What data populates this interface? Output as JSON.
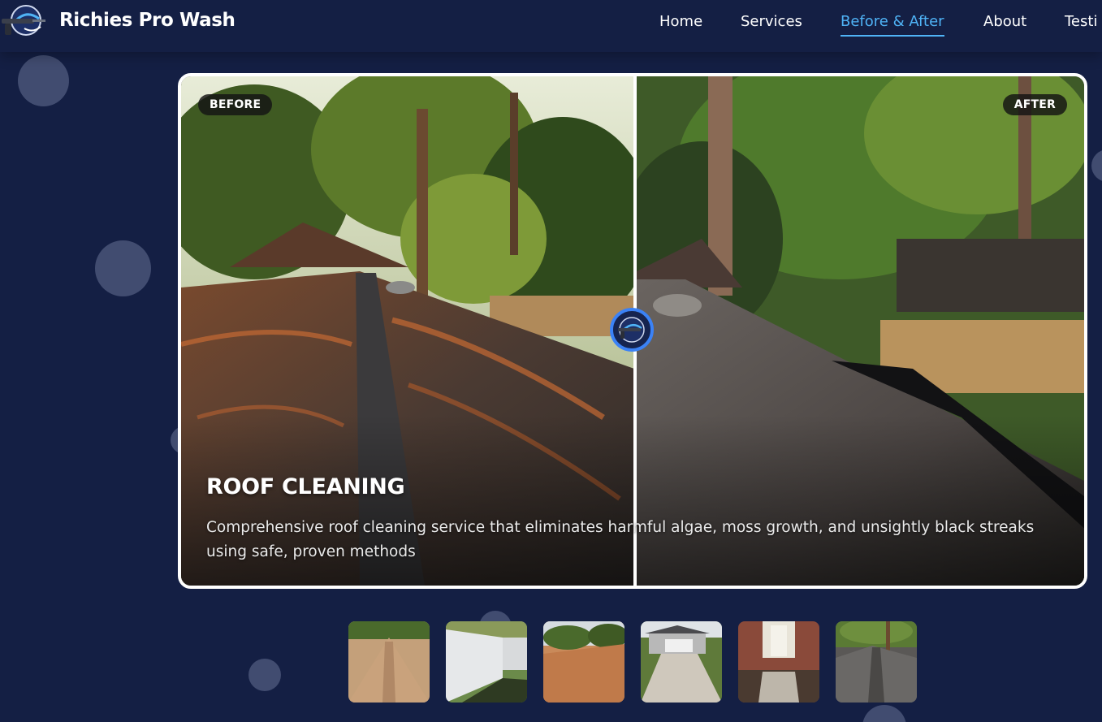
{
  "brand": {
    "name": "Richies Pro Wash",
    "logo_icon": "pressure-washer-gun-logo-icon"
  },
  "nav": {
    "items": [
      {
        "label": "Home",
        "active": false
      },
      {
        "label": "Services",
        "active": false
      },
      {
        "label": "Before & After",
        "active": true
      },
      {
        "label": "About",
        "active": false
      },
      {
        "label": "Testi",
        "active": false
      }
    ]
  },
  "slider": {
    "before_label": "BEFORE",
    "after_label": "AFTER",
    "title": "ROOF CLEANING",
    "description": "Comprehensive roof cleaning service that eliminates harmful algae, moss growth, and unsightly black streaks using safe, proven methods",
    "handle_icon": "pressure-washer-gun-logo-icon",
    "split_position": 0.5
  },
  "thumbnails": [
    {
      "name": "roof-clean-thumb",
      "active": false
    },
    {
      "name": "white-fence-thumb",
      "active": false
    },
    {
      "name": "orange-roof-thumb",
      "active": false
    },
    {
      "name": "driveway-house-thumb",
      "active": false
    },
    {
      "name": "brick-entry-walkway-thumb",
      "active": false
    },
    {
      "name": "dark-roof-thumb",
      "active": false
    }
  ],
  "colors": {
    "background": "#141f44",
    "accent": "#4fb3f6",
    "handle_ring": "#3b82f6",
    "text": "#ffffff"
  }
}
